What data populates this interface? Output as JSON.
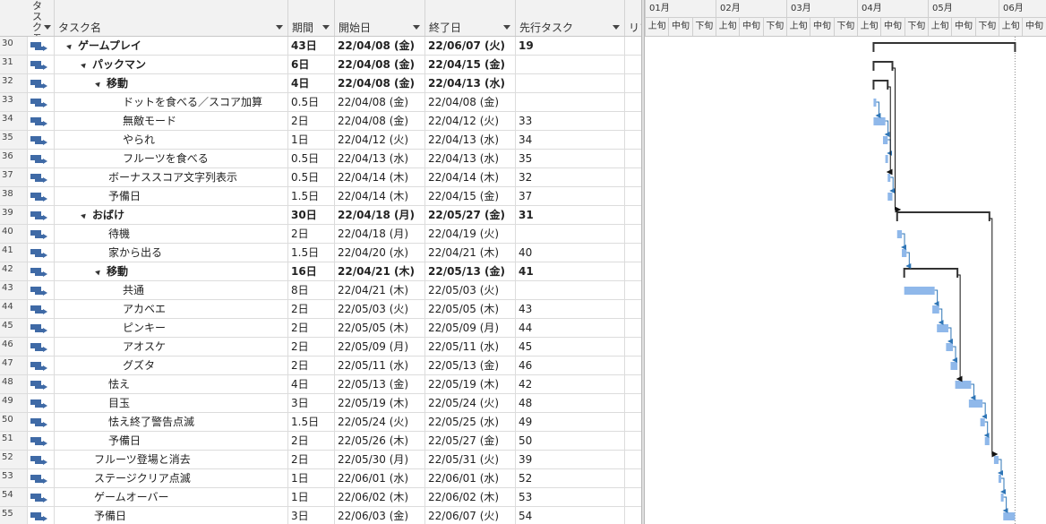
{
  "columns": {
    "mode": "タスクモード",
    "name": "タスク名",
    "duration": "期間",
    "start": "開始日",
    "end": "終了日",
    "pred": "先行タスク",
    "res": "リソース名"
  },
  "rows": [
    {
      "id": "30",
      "name": "ゲームプレイ",
      "level": 1,
      "summary": true,
      "duration": "43日",
      "start": "22/04/08 (金)",
      "end": "22/06/07 (火)",
      "pred": "19"
    },
    {
      "id": "31",
      "name": "パックマン",
      "level": 2,
      "summary": true,
      "duration": "6日",
      "start": "22/04/08 (金)",
      "end": "22/04/15 (金)",
      "pred": ""
    },
    {
      "id": "32",
      "name": "移動",
      "level": 3,
      "summary": true,
      "duration": "4日",
      "start": "22/04/08 (金)",
      "end": "22/04/13 (水)",
      "pred": ""
    },
    {
      "id": "33",
      "name": "ドットを食べる／スコア加算",
      "level": 4,
      "summary": false,
      "duration": "0.5日",
      "start": "22/04/08 (金)",
      "end": "22/04/08 (金)",
      "pred": ""
    },
    {
      "id": "34",
      "name": "無敵モード",
      "level": 4,
      "summary": false,
      "duration": "2日",
      "start": "22/04/08 (金)",
      "end": "22/04/12 (火)",
      "pred": "33"
    },
    {
      "id": "35",
      "name": "やられ",
      "level": 4,
      "summary": false,
      "duration": "1日",
      "start": "22/04/12 (火)",
      "end": "22/04/13 (水)",
      "pred": "34"
    },
    {
      "id": "36",
      "name": "フルーツを食べる",
      "level": 4,
      "summary": false,
      "duration": "0.5日",
      "start": "22/04/13 (水)",
      "end": "22/04/13 (水)",
      "pred": "35"
    },
    {
      "id": "37",
      "name": "ボーナススコア文字列表示",
      "level": 3,
      "summary": false,
      "duration": "0.5日",
      "start": "22/04/14 (木)",
      "end": "22/04/14 (木)",
      "pred": "32"
    },
    {
      "id": "38",
      "name": "予備日",
      "level": 3,
      "summary": false,
      "duration": "1.5日",
      "start": "22/04/14 (木)",
      "end": "22/04/15 (金)",
      "pred": "37"
    },
    {
      "id": "39",
      "name": "おばけ",
      "level": 2,
      "summary": true,
      "duration": "30日",
      "start": "22/04/18 (月)",
      "end": "22/05/27 (金)",
      "pred": "31"
    },
    {
      "id": "40",
      "name": "待機",
      "level": 3,
      "summary": false,
      "duration": "2日",
      "start": "22/04/18 (月)",
      "end": "22/04/19 (火)",
      "pred": ""
    },
    {
      "id": "41",
      "name": "家から出る",
      "level": 3,
      "summary": false,
      "duration": "1.5日",
      "start": "22/04/20 (水)",
      "end": "22/04/21 (木)",
      "pred": "40"
    },
    {
      "id": "42",
      "name": "移動",
      "level": 3,
      "summary": true,
      "duration": "16日",
      "start": "22/04/21 (木)",
      "end": "22/05/13 (金)",
      "pred": "41"
    },
    {
      "id": "43",
      "name": "共通",
      "level": 4,
      "summary": false,
      "duration": "8日",
      "start": "22/04/21 (木)",
      "end": "22/05/03 (火)",
      "pred": ""
    },
    {
      "id": "44",
      "name": "アカベエ",
      "level": 4,
      "summary": false,
      "duration": "2日",
      "start": "22/05/03 (火)",
      "end": "22/05/05 (木)",
      "pred": "43"
    },
    {
      "id": "45",
      "name": "ピンキー",
      "level": 4,
      "summary": false,
      "duration": "2日",
      "start": "22/05/05 (木)",
      "end": "22/05/09 (月)",
      "pred": "44"
    },
    {
      "id": "46",
      "name": "アオスケ",
      "level": 4,
      "summary": false,
      "duration": "2日",
      "start": "22/05/09 (月)",
      "end": "22/05/11 (水)",
      "pred": "45"
    },
    {
      "id": "47",
      "name": "グズタ",
      "level": 4,
      "summary": false,
      "duration": "2日",
      "start": "22/05/11 (水)",
      "end": "22/05/13 (金)",
      "pred": "46"
    },
    {
      "id": "48",
      "name": "怯え",
      "level": 3,
      "summary": false,
      "duration": "4日",
      "start": "22/05/13 (金)",
      "end": "22/05/19 (木)",
      "pred": "42"
    },
    {
      "id": "49",
      "name": "目玉",
      "level": 3,
      "summary": false,
      "duration": "3日",
      "start": "22/05/19 (木)",
      "end": "22/05/24 (火)",
      "pred": "48"
    },
    {
      "id": "50",
      "name": "怯え終了警告点滅",
      "level": 3,
      "summary": false,
      "duration": "1.5日",
      "start": "22/05/24 (火)",
      "end": "22/05/25 (水)",
      "pred": "49"
    },
    {
      "id": "51",
      "name": "予備日",
      "level": 3,
      "summary": false,
      "duration": "2日",
      "start": "22/05/26 (木)",
      "end": "22/05/27 (金)",
      "pred": "50"
    },
    {
      "id": "52",
      "name": "フルーツ登場と消去",
      "level": 2,
      "summary": false,
      "duration": "2日",
      "start": "22/05/30 (月)",
      "end": "22/05/31 (火)",
      "pred": "39"
    },
    {
      "id": "53",
      "name": "ステージクリア点滅",
      "level": 2,
      "summary": false,
      "duration": "1日",
      "start": "22/06/01 (水)",
      "end": "22/06/01 (水)",
      "pred": "52"
    },
    {
      "id": "54",
      "name": "ゲームオーバー",
      "level": 2,
      "summary": false,
      "duration": "1日",
      "start": "22/06/02 (木)",
      "end": "22/06/02 (木)",
      "pred": "53"
    },
    {
      "id": "55",
      "name": "予備日",
      "level": 2,
      "summary": false,
      "duration": "3日",
      "start": "22/06/03 (金)",
      "end": "22/06/07 (火)",
      "pred": "54"
    }
  ],
  "timeline": {
    "months": [
      "01月",
      "02月",
      "03月",
      "04月",
      "05月",
      "06月"
    ],
    "dekads": [
      "上旬",
      "中旬",
      "下旬"
    ],
    "colors": {
      "bar": "#8fb8ea",
      "summary": "#333333",
      "link": "#2e75b6",
      "grid": "#cfcfcf"
    }
  }
}
